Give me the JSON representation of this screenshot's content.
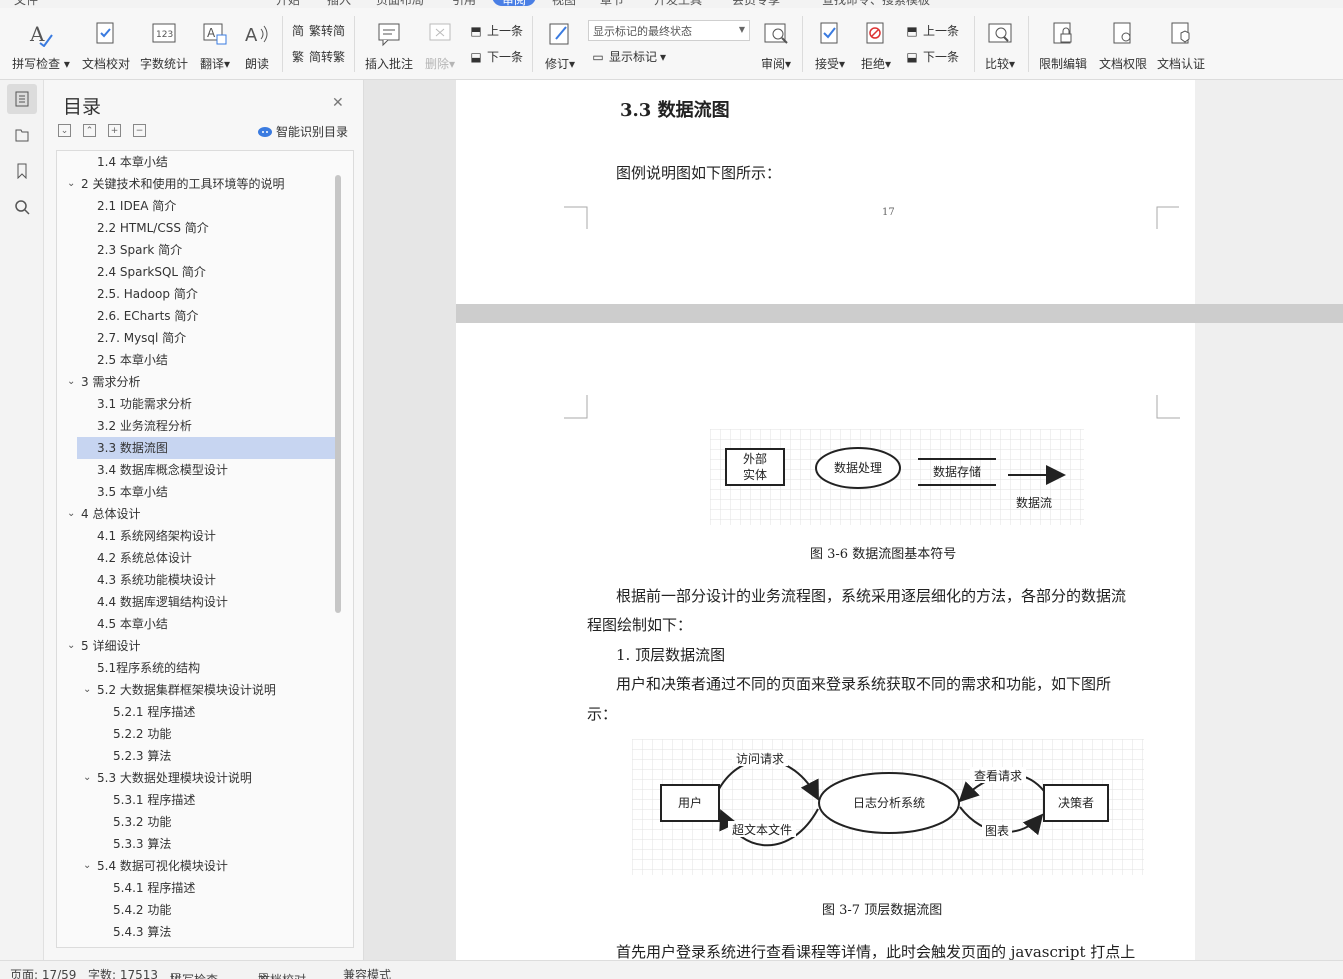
{
  "tabs": [
    "文件",
    "开始",
    "插入",
    "页面布局",
    "引用",
    "审阅",
    "视图",
    "章节",
    "开发工具",
    "会员专享"
  ],
  "active_tab": "审阅",
  "search_placeholder": "查找命令、搜索模板",
  "ribbon": {
    "spell_check": "拼写检查",
    "doc_proof": "文档校对",
    "word_count": "字数统计",
    "translate": "翻译",
    "read_aloud": "朗读",
    "trad_to_simp": "繁转简",
    "simp_to_trad": "简转繁",
    "insert_comment": "插入批注",
    "delete": "删除",
    "prev_item": "上一条",
    "next_item": "下一条",
    "track_changes": "修订",
    "markup_state": "显示标记的最终状态",
    "show_markup": "显示标记",
    "review": "审阅",
    "accept": "接受",
    "reject": "拒绝",
    "prev_change": "上一条",
    "next_change": "下一条",
    "compare": "比较",
    "restrict_editing": "限制编辑",
    "doc_permission": "文档权限",
    "doc_certify": "文档认证"
  },
  "toc": {
    "title": "目录",
    "smart_detect": "智能识别目录",
    "items": [
      {
        "text": "1.4  本章小结",
        "level": 2,
        "collapsible": false
      },
      {
        "text": "2   关键技术和使用的工具环境等的说明",
        "level": 1,
        "collapsible": true
      },
      {
        "text": "2.1 IDEA 简介",
        "level": 2,
        "collapsible": false
      },
      {
        "text": "2.2 HTML/CSS 简介",
        "level": 2,
        "collapsible": false
      },
      {
        "text": "2.3 Spark 简介",
        "level": 2,
        "collapsible": false
      },
      {
        "text": "2.4 SparkSQL 简介",
        "level": 2,
        "collapsible": false
      },
      {
        "text": "2.5. Hadoop 简介",
        "level": 2,
        "collapsible": false
      },
      {
        "text": "2.6. ECharts 简介",
        "level": 2,
        "collapsible": false
      },
      {
        "text": "2.7. Mysql 简介",
        "level": 2,
        "collapsible": false
      },
      {
        "text": "2.5  本章小结",
        "level": 2,
        "collapsible": false
      },
      {
        "text": "3   需求分析",
        "level": 1,
        "collapsible": true
      },
      {
        "text": "3.1  功能需求分析",
        "level": 2,
        "collapsible": false
      },
      {
        "text": "3.2  业务流程分析",
        "level": 2,
        "collapsible": false
      },
      {
        "text": "3.3  数据流图",
        "level": 2,
        "collapsible": false,
        "selected": true
      },
      {
        "text": "3.4  数据库概念模型设计",
        "level": 2,
        "collapsible": false
      },
      {
        "text": "3.5  本章小结",
        "level": 2,
        "collapsible": false
      },
      {
        "text": "4   总体设计",
        "level": 1,
        "collapsible": true
      },
      {
        "text": "4.1  系统网络架构设计",
        "level": 2,
        "collapsible": false
      },
      {
        "text": "4.2  系统总体设计",
        "level": 2,
        "collapsible": false
      },
      {
        "text": "4.3  系统功能模块设计",
        "level": 2,
        "collapsible": false
      },
      {
        "text": "4.4  数据库逻辑结构设计",
        "level": 2,
        "collapsible": false
      },
      {
        "text": "4.5  本章小结",
        "level": 2,
        "collapsible": false
      },
      {
        "text": "5   详细设计",
        "level": 1,
        "collapsible": true
      },
      {
        "text": "5.1程序系统的结构",
        "level": 2,
        "collapsible": false
      },
      {
        "text": "5.2    大数据集群框架模块设计说明",
        "level": 2,
        "collapsible": true
      },
      {
        "text": "5.2.1  程序描述",
        "level": 3,
        "collapsible": false
      },
      {
        "text": "5.2.2  功能",
        "level": 3,
        "collapsible": false
      },
      {
        "text": "5.2.3  算法",
        "level": 3,
        "collapsible": false
      },
      {
        "text": "5.3    大数据处理模块设计说明",
        "level": 2,
        "collapsible": true
      },
      {
        "text": "5.3.1  程序描述",
        "level": 3,
        "collapsible": false
      },
      {
        "text": "5.3.2  功能",
        "level": 3,
        "collapsible": false
      },
      {
        "text": "5.3.3  算法",
        "level": 3,
        "collapsible": false
      },
      {
        "text": "5.4    数据可视化模块设计",
        "level": 2,
        "collapsible": true
      },
      {
        "text": "5.4.1  程序描述",
        "level": 3,
        "collapsible": false
      },
      {
        "text": "5.4.2  功能",
        "level": 3,
        "collapsible": false
      },
      {
        "text": "5.4.3  算法",
        "level": 3,
        "collapsible": false
      }
    ]
  },
  "document": {
    "heading": "3.3  数据流图",
    "legend_intro": "图例说明图如下图所示：",
    "page_number": "17",
    "fig6": {
      "external_entity_line1": "外部",
      "external_entity_line2": "实体",
      "process": "数据处理",
      "data_store": "数据存储",
      "data_flow": "数据流",
      "caption": "图 3-6 数据流图基本符号"
    },
    "para1_line1": "根据前一部分设计的业务流程图，系统采用逐层细化的方法，各部分的数据流",
    "para1_line2": "程图绘制如下：",
    "list_item": "1.  顶层数据流图",
    "para2_line1": "用户和决策者通过不同的页面来登录系统获取不同的需求和功能，如下图所",
    "para2_line2": "示：",
    "fig7": {
      "user": "用户",
      "system": "日志分析系统",
      "decision_maker": "决策者",
      "visit_request": "访问请求",
      "hypertext": "超文本文件",
      "query_request": "查看请求",
      "chart": "图表",
      "caption": "图 3-7  顶层数据流图"
    },
    "para3": "首先用户登录系统进行查看课程等详情，此时会触发页面的 javascript 打点上"
  },
  "status": {
    "page": "页面: 17/59",
    "word_count": "字数: 17513",
    "spell_check": "拼写检查",
    "doc_proof": "文档校对",
    "compat_mode": "兼容模式"
  }
}
